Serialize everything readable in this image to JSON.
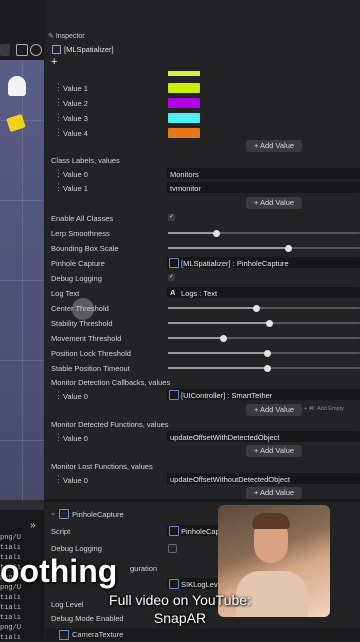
{
  "inspector": {
    "title": "Inspector",
    "object_name": "[MLSpatializer]",
    "add_symbol": "+"
  },
  "color_values": [
    {
      "label": "Value 1",
      "color": "#c8f000"
    },
    {
      "label": "Value 2",
      "color": "#b400e6"
    },
    {
      "label": "Value 3",
      "color": "#4ff0f4"
    },
    {
      "label": "Value 4",
      "color": "#e7771b"
    }
  ],
  "add_value": "+ Add Value",
  "class_labels": {
    "header": "Class Labels, values",
    "items": [
      {
        "label": "Value 0",
        "value": "Monitors"
      },
      {
        "label": "Value 1",
        "value": "tvmonitor"
      }
    ]
  },
  "props": {
    "enable_all_classes": "Enable All Classes",
    "lerp_smoothness": "Lerp Smoothness",
    "bounding_box_scale": "Bounding Box Scale",
    "pinhole_capture": "Pinhole Capture",
    "pinhole_capture_value": "[MLSpatializer] : PinholeCapture",
    "debug_logging": "Debug Logging",
    "log_text": "Log Text",
    "log_text_value": "Logs : Text",
    "center_threshold": "Center Threshold",
    "stability_threshold": "Stability Threshold",
    "movement_threshold": "Movement Threshold",
    "position_lock_threshold": "Position Lock Threshold",
    "stable_position_timeout": "Stable Position Timeout"
  },
  "slider_levels": {
    "lerp_smoothness": 0.25,
    "bounding_box_scale": 0.63,
    "center_threshold": 0.46,
    "stability_threshold": 0.53,
    "movement_threshold": 0.29,
    "position_lock_threshold": 0.52,
    "stable_position_timeout": 0.52
  },
  "callbacks": {
    "header": "Monitor Detection Callbacks, values",
    "value_label": "Value 0",
    "value": "[UIController] : SmartTether",
    "add_empty": "+ ⌘: Add Empty"
  },
  "detected": {
    "header": "Monitor Detected Functions, values",
    "value_label": "Value 0",
    "value": "updateOffsetWithDetectedObject"
  },
  "lost": {
    "header": "Monitor Lost Functions, values",
    "value_label": "Value 0",
    "value": "updateOffsetWithoutDetectedObject"
  },
  "component2": {
    "title": "PinholeCapture",
    "script_label": "Script",
    "script_value": "PinholeCap",
    "debug_logging": "Debug Logging",
    "log_level": "Log Level",
    "log_value": "SIKLogLeve",
    "configuration_fragment": "guration",
    "debug_mode": "Debug Mode Enabled",
    "camera_texture": "CameraTexture"
  },
  "assets": [
    "png/U",
    "tiali",
    "tiali",
    "tiali",
    "png/U",
    "png/U",
    "tiali",
    "tiali",
    "tiali",
    "png/U",
    "tiali"
  ],
  "overlay": {
    "caption": "oothing",
    "line1": "Full video on YouTube:",
    "line2": "SnapAR"
  }
}
